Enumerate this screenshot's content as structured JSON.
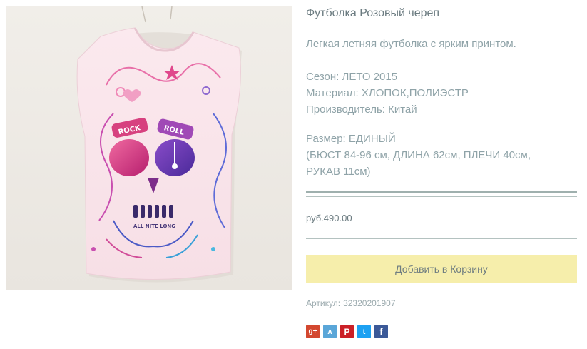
{
  "product": {
    "title": "Футболка Розовый череп",
    "description": "Легкая летняя футболка с ярким принтом.",
    "specs": [
      "Сезон: ЛЕТО 2015",
      "Материал: ХЛОПОК,ПОЛИЭСТР",
      "Производитель: Китай"
    ],
    "size": [
      "Размер: ЕДИНЫЙ",
      "(БЮСТ 84-96 см, ДЛИНА 62см, ПЛЕЧИ 40см,",
      "РУКАВ 11см)"
    ],
    "price": "руб.490.00",
    "add_to_cart_label": "Добавить в Корзину",
    "sku_label": "Артикул:",
    "sku_value": "32320201907"
  },
  "print_text": {
    "rock": "ROCK",
    "roll": "ROLL",
    "tagline": "ALL NITE LONG"
  },
  "share": {
    "gplus_glyph": "g+",
    "vk_glyph": "ʌ",
    "pinterest_glyph": "P",
    "twitter_glyph": "t",
    "facebook_glyph": "f"
  },
  "colors": {
    "cart_button": "#f6eeab",
    "rule": "#9fb0ae",
    "text": "#8fa3a8"
  },
  "icons": [
    "gplus-icon",
    "vk-icon",
    "pinterest-icon",
    "twitter-icon",
    "facebook-icon"
  ]
}
